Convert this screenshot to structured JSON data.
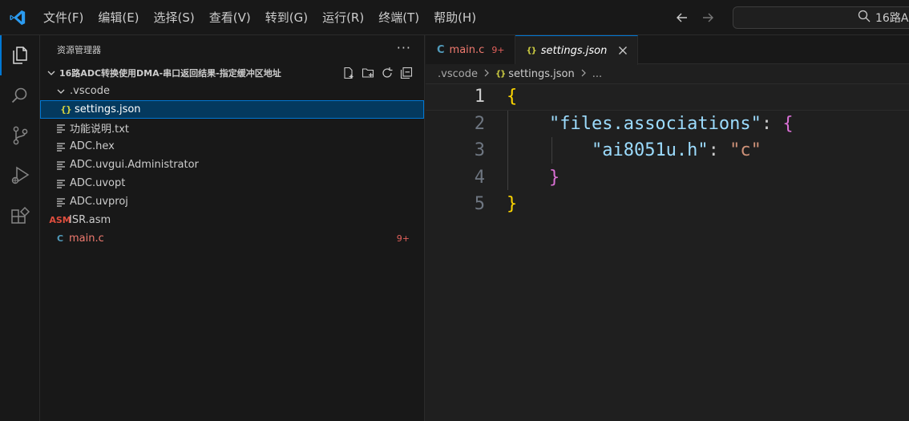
{
  "titlebar": {
    "menu": [
      "文件(F)",
      "编辑(E)",
      "选择(S)",
      "查看(V)",
      "转到(G)",
      "运行(R)",
      "终端(T)",
      "帮助(H)"
    ],
    "search_text": "16路A"
  },
  "activity": [
    "explorer-icon",
    "search-icon",
    "source-control-icon",
    "run-debug-icon",
    "extensions-icon"
  ],
  "sidebar": {
    "title": "资源管理器",
    "more": "···",
    "folder_name": "16路ADC转换使用DMA-串口返回结果-指定缓冲区地址",
    "items": [
      {
        "label": ".vscode",
        "icon": "chevron-down-icon"
      },
      {
        "label": "settings.json",
        "icon": "json-icon"
      },
      {
        "label": "功能说明.txt",
        "icon": "text-file-icon"
      },
      {
        "label": "ADC.hex",
        "icon": "text-file-icon"
      },
      {
        "label": "ADC.uvgui.Administrator",
        "icon": "text-file-icon"
      },
      {
        "label": "ADC.uvopt",
        "icon": "text-file-icon"
      },
      {
        "label": "ADC.uvproj",
        "icon": "text-file-icon"
      },
      {
        "label": "ISR.asm",
        "icon": "asm-icon",
        "icon_text": "ASM"
      },
      {
        "label": "main.c",
        "icon": "c-icon",
        "icon_text": "C",
        "badge": "9+"
      }
    ],
    "json_icon_text": "{}"
  },
  "editor": {
    "tabs": [
      {
        "label": "main.c",
        "badge": "9+",
        "icon_text": "C"
      },
      {
        "label": "settings.json",
        "icon_text": "{}"
      }
    ],
    "breadcrumb": {
      "folder": ".vscode",
      "file": "settings.json",
      "more": "..."
    },
    "lines": [
      {
        "num": "1",
        "open": "{"
      },
      {
        "num": "2",
        "key": "\"files.associations\"",
        "colon": ": ",
        "open": "{"
      },
      {
        "num": "3",
        "key": "\"ai8051u.h\"",
        "colon": ": ",
        "value": "\"c\""
      },
      {
        "num": "4",
        "close": "}"
      },
      {
        "num": "5",
        "close": "}"
      }
    ]
  },
  "colors": {
    "accent": "#0078d4",
    "error": "#e2605b",
    "json_key": "#9cdcfe",
    "json_string": "#ce9178",
    "bracket_level1": "#ffd700",
    "bracket_level2": "#da70d6"
  }
}
